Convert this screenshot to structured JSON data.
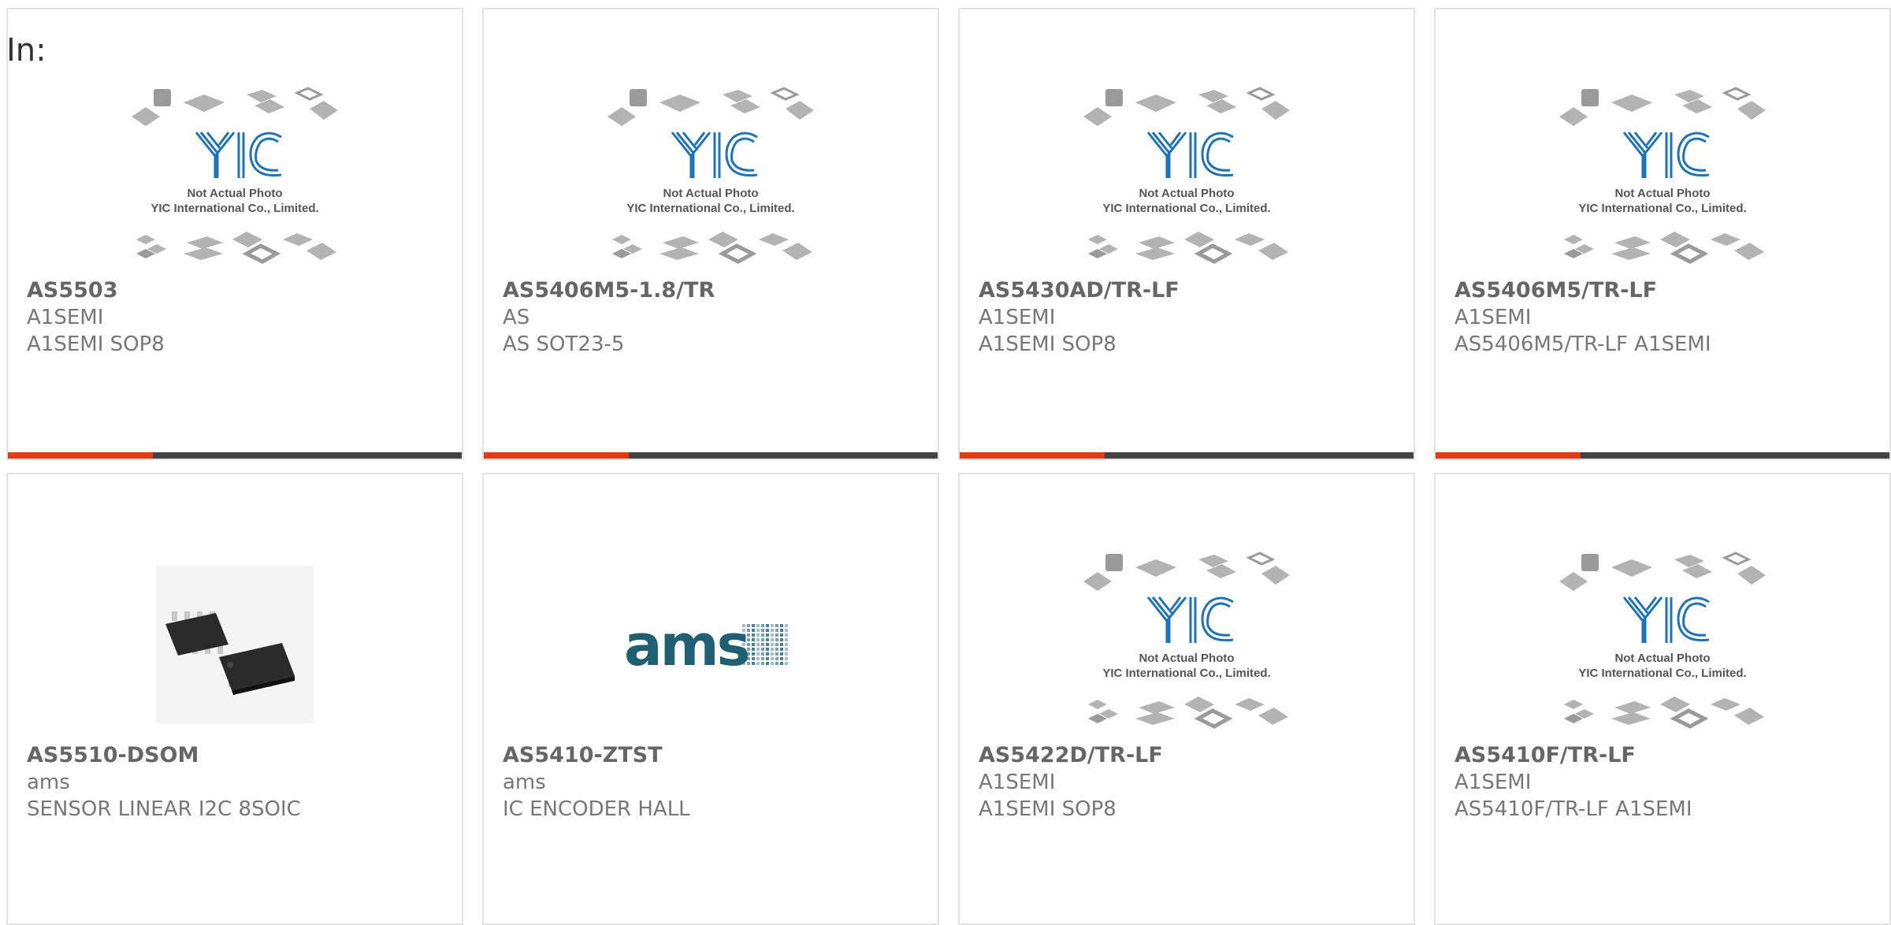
{
  "header": {
    "in_label": "In:"
  },
  "placeholder_image": {
    "logo_text": "YIC",
    "caption_line1": "Not Actual Photo",
    "caption_line2": "YIC International Co., Limited."
  },
  "brand_logo": {
    "text": "ams"
  },
  "colors": {
    "accent": "#e23b16",
    "bar": "#444444",
    "yic_blue": "#1e73b8",
    "ams_teal": "#1f5f73"
  },
  "products": [
    {
      "part": "AS5503",
      "manufacturer": "A1SEMI",
      "description": "A1SEMI SOP8",
      "image": "yic-placeholder",
      "accent_fraction": 0.32
    },
    {
      "part": "AS5406M5-1.8/TR",
      "manufacturer": "AS",
      "description": "AS SOT23-5",
      "image": "yic-placeholder",
      "accent_fraction": 0.32
    },
    {
      "part": "AS5430AD/TR-LF",
      "manufacturer": "A1SEMI",
      "description": "A1SEMI SOP8",
      "image": "yic-placeholder",
      "accent_fraction": 0.32
    },
    {
      "part": "AS5406M5/TR-LF",
      "manufacturer": "A1SEMI",
      "description": "AS5406M5/TR-LF A1SEMI",
      "image": "yic-placeholder",
      "accent_fraction": 0.32
    },
    {
      "part": "AS5510-DSOM",
      "manufacturer": "ams",
      "description": "SENSOR LINEAR I2C 8SOIC",
      "image": "soic-chip-photo",
      "accent_fraction": 0
    },
    {
      "part": "AS5410-ZTST",
      "manufacturer": "ams",
      "description": "IC ENCODER HALL",
      "image": "ams-logo",
      "accent_fraction": 0
    },
    {
      "part": "AS5422D/TR-LF",
      "manufacturer": "A1SEMI",
      "description": "A1SEMI SOP8",
      "image": "yic-placeholder",
      "accent_fraction": 0
    },
    {
      "part": "AS5410F/TR-LF",
      "manufacturer": "A1SEMI",
      "description": "AS5410F/TR-LF A1SEMI",
      "image": "yic-placeholder",
      "accent_fraction": 0
    }
  ]
}
